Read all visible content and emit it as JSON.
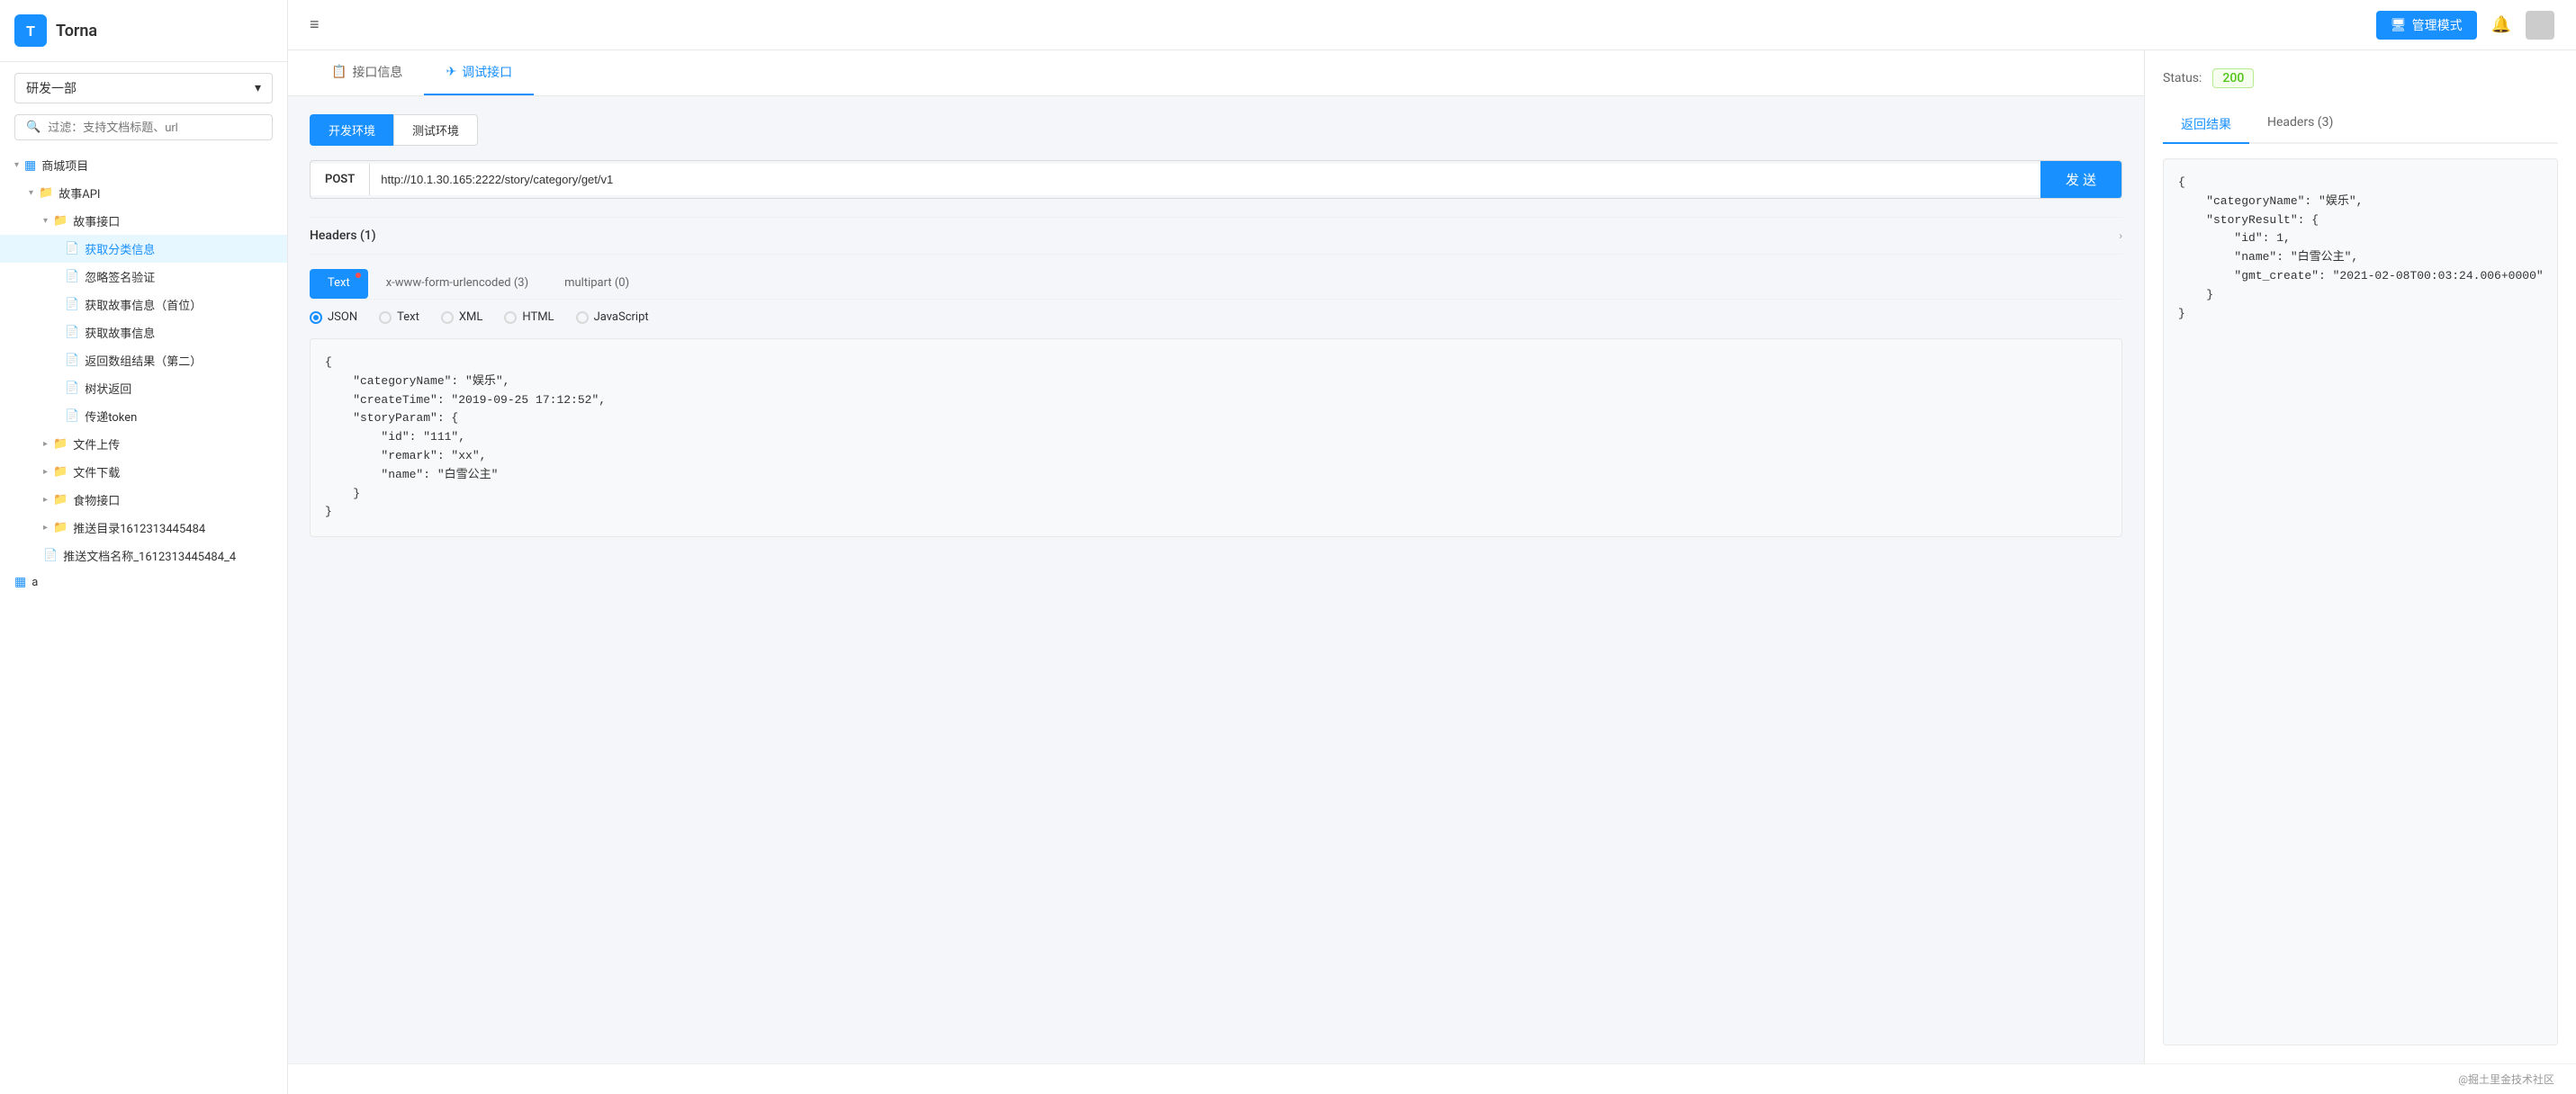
{
  "app": {
    "title": "Torna",
    "logo_letter": "T"
  },
  "sidebar": {
    "dept_label": "研发一部",
    "search_placeholder": "过滤：支持文档标题、url",
    "tree": [
      {
        "id": "project1",
        "label": "商城项目",
        "level": 0,
        "type": "project",
        "icon": "▦",
        "expanded": true
      },
      {
        "id": "api1",
        "label": "故事API",
        "level": 1,
        "type": "folder",
        "icon": "📁",
        "expanded": true
      },
      {
        "id": "folder1",
        "label": "故事接口",
        "level": 2,
        "type": "folder",
        "icon": "📁",
        "expanded": true
      },
      {
        "id": "item1",
        "label": "获取分类信息",
        "level": 3,
        "type": "doc",
        "icon": "📄",
        "active": true
      },
      {
        "id": "item2",
        "label": "忽略签名验证",
        "level": 3,
        "type": "doc",
        "icon": "📄"
      },
      {
        "id": "item3",
        "label": "获取故事信息（首位）",
        "level": 3,
        "type": "doc",
        "icon": "📄"
      },
      {
        "id": "item4",
        "label": "获取故事信息",
        "level": 3,
        "type": "doc",
        "icon": "📄"
      },
      {
        "id": "item5",
        "label": "返回数组结果（第二）",
        "level": 3,
        "type": "doc",
        "icon": "📄"
      },
      {
        "id": "item6",
        "label": "树状返回",
        "level": 3,
        "type": "doc",
        "icon": "📄"
      },
      {
        "id": "item7",
        "label": "传递token",
        "level": 3,
        "type": "doc",
        "icon": "📄"
      },
      {
        "id": "folder2",
        "label": "文件上传",
        "level": 1,
        "type": "folder",
        "icon": "📁"
      },
      {
        "id": "folder3",
        "label": "文件下载",
        "level": 1,
        "type": "folder",
        "icon": "📁"
      },
      {
        "id": "folder4",
        "label": "食物接口",
        "level": 1,
        "type": "folder",
        "icon": "📁"
      },
      {
        "id": "folder5",
        "label": "推送目录1612313445484",
        "level": 1,
        "type": "folder",
        "icon": "📁"
      },
      {
        "id": "item8",
        "label": "推送文档名称_1612313445484_4",
        "level": 1,
        "type": "doc",
        "icon": "📄"
      },
      {
        "id": "item9",
        "label": "a",
        "level": 0,
        "type": "project",
        "icon": "▦"
      }
    ]
  },
  "topbar": {
    "menu_icon": "≡",
    "admin_btn": "管理模式",
    "bell_icon": "🔔"
  },
  "tabs": [
    {
      "id": "info",
      "label": "接口信息",
      "icon": "📋",
      "active": false
    },
    {
      "id": "debug",
      "label": "调试接口",
      "icon": "✈",
      "active": true
    }
  ],
  "api": {
    "env_btns": [
      {
        "label": "开发环境",
        "active": true
      },
      {
        "label": "测试环境",
        "active": false
      }
    ],
    "method": "POST",
    "url": "http://10.1.30.165:2222/story/category/get/v1",
    "send_btn": "发 送",
    "headers_title": "Headers (1)",
    "body_tabs": [
      {
        "label": "Text",
        "active": false,
        "has_dot": true
      },
      {
        "label": "x-www-form-urlencoded (3)",
        "active": false
      },
      {
        "label": "multipart (0)",
        "active": false
      }
    ],
    "radio_options": [
      {
        "label": "JSON",
        "selected": true
      },
      {
        "label": "Text",
        "selected": false
      },
      {
        "label": "XML",
        "selected": false
      },
      {
        "label": "HTML",
        "selected": false
      },
      {
        "label": "JavaScript",
        "selected": false
      }
    ],
    "body_content": "{\n    \"categoryName\": \"娱乐\",\n    \"createTime\": \"2019-09-25 17:12:52\",\n    \"storyParam\": {\n        \"id\": \"111\",\n        \"remark\": \"xx\",\n        \"name\": \"白雪公主\"\n    }\n}"
  },
  "result": {
    "status_label": "Status:",
    "status_code": "200",
    "tabs": [
      {
        "label": "返回结果",
        "active": true
      },
      {
        "label": "Headers (3)",
        "active": false
      }
    ],
    "content": "{\n    \"categoryName\": \"娱乐\",\n    \"storyResult\": {\n        \"id\": 1,\n        \"name\": \"白雪公主\",\n        \"gmt_create\": \"2021-02-08T00:03:24.006+0000\"\n    }\n}"
  },
  "footer": {
    "text": "@掘土里金技术社区"
  }
}
